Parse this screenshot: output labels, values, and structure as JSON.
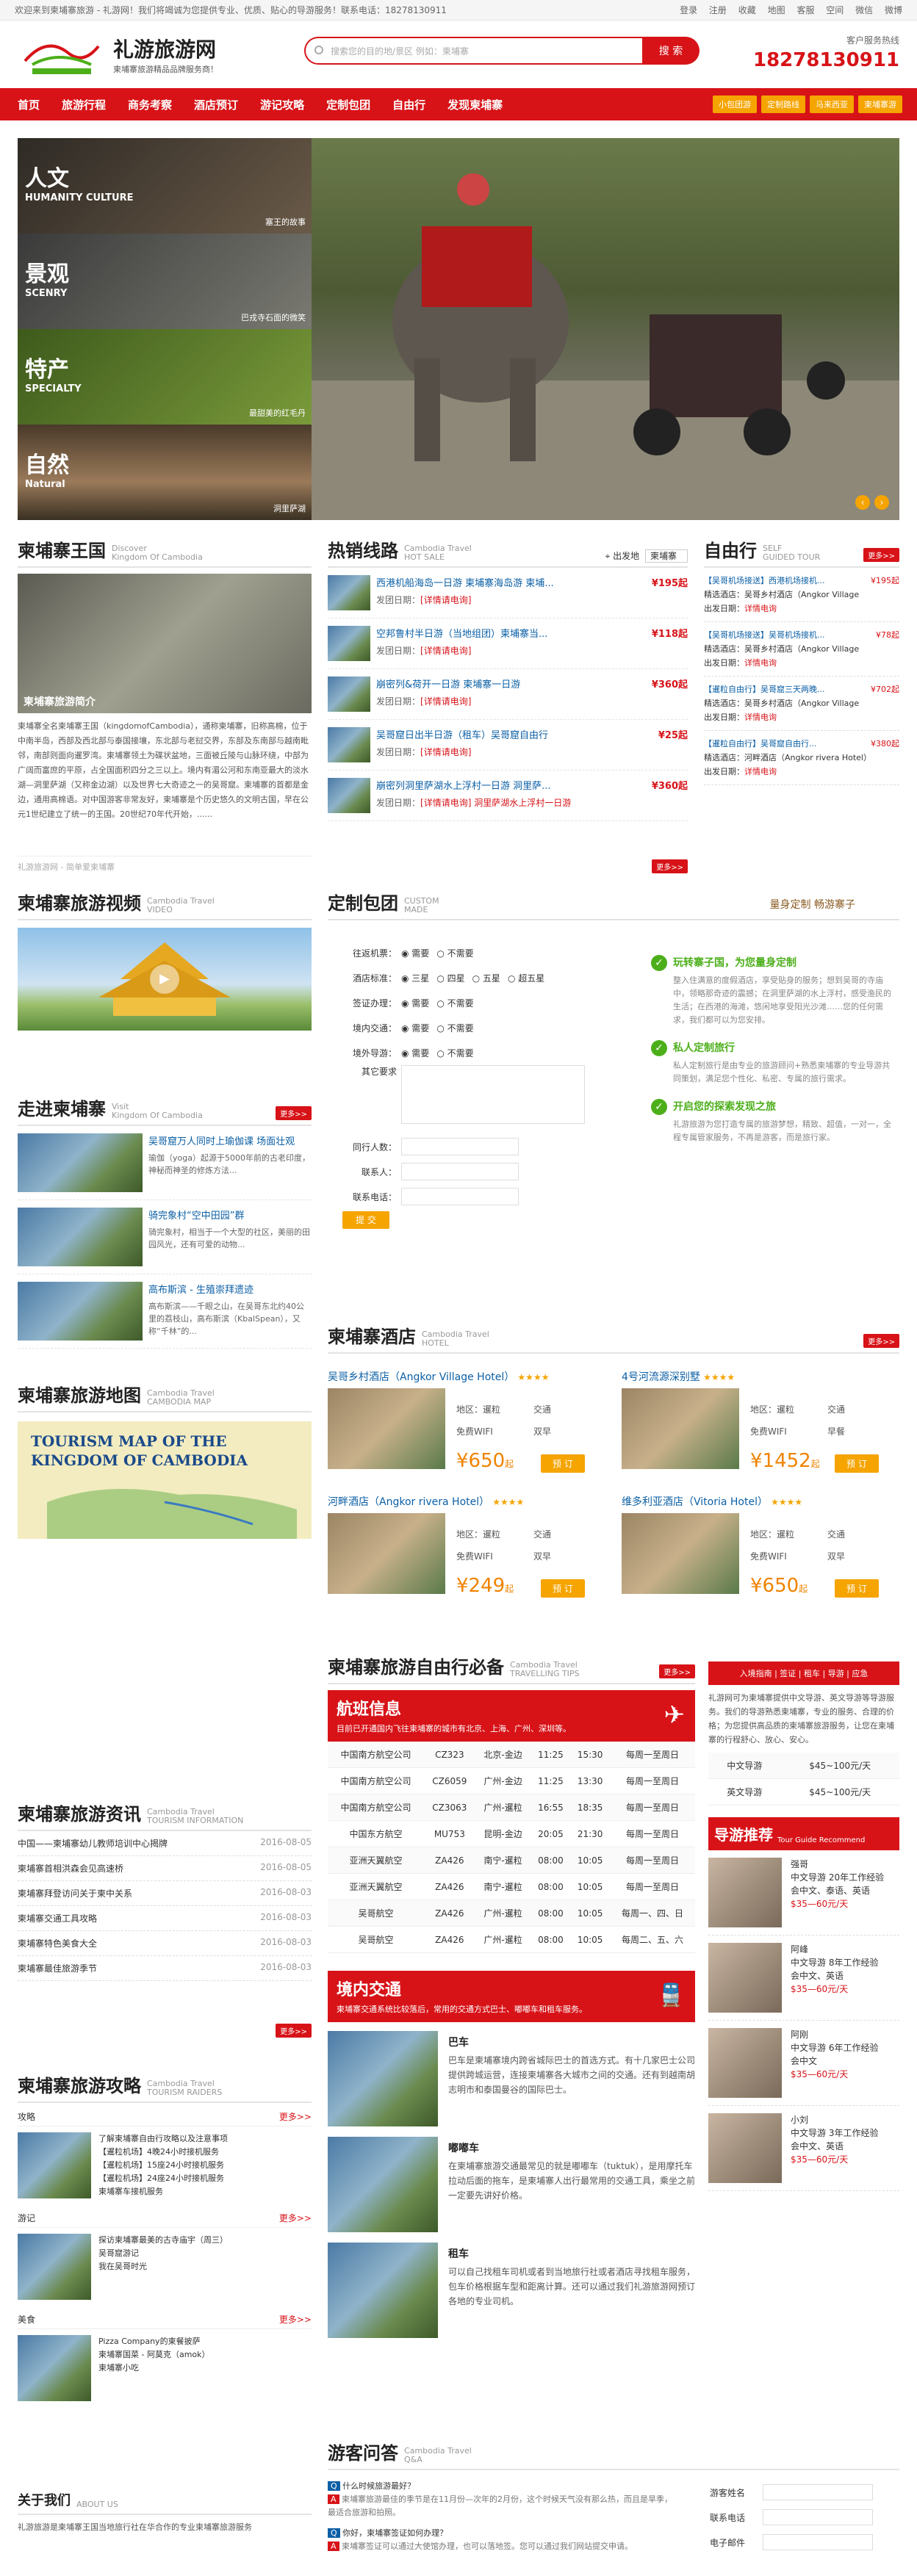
{
  "topbar": {
    "welcome": "欢迎来到柬埔寨旅游 - 礼游网！我们将竭诚为您提供专业、优质、贴心的导游服务！联系电话：18278130911",
    "links": [
      "登录",
      "注册",
      "收藏",
      "地图",
      "客服",
      "空间",
      "微信",
      "微博"
    ]
  },
  "header": {
    "site_name": "礼游旅游网",
    "slogan": "柬埔寨旅游精品品牌服务商！",
    "search_placeholder": "搜索您的目的地/景区 例如：柬埔寨",
    "search_button": "搜 索",
    "hotline_label": "客户服务热线",
    "hotline": "18278130911"
  },
  "nav": {
    "items": [
      "首页",
      "旅游行程",
      "商务考察",
      "酒店预订",
      "游记攻略",
      "定制包团",
      "自由行",
      "发现柬埔寨"
    ],
    "tags": [
      "小包团游",
      "定制路线",
      "马来西亚",
      "柬埔寨游"
    ]
  },
  "banner": {
    "cells": [
      {
        "t": "人文",
        "e": "HUMANITY CULTURE",
        "cap": "塞王的故事"
      },
      {
        "t": "景观",
        "e": "SCENRY",
        "cap": "巴戎寺石面的微笑"
      },
      {
        "t": "特产",
        "e": "SPECIALTY",
        "cap": "最甜美的红毛丹"
      },
      {
        "t": "自然",
        "e": "Natural",
        "cap": "洞里萨湖"
      }
    ]
  },
  "kingdom": {
    "title": "柬埔寨王国",
    "en1": "Discover",
    "en2": "Kingdom Of Cambodia",
    "img_caption": "柬埔寨旅游简介",
    "desc": "柬埔寨全名柬埔寨王国（kingdomofCambodia），通称柬埔寨，旧称高棉，位于中南半岛，西部及西北部与泰国接壤，东北部与老挝交界，东部及东南部与越南毗邻，南部则面向暹罗湾。柬埔寨领土为碟状盆地，三面被丘陵与山脉环绕，中部为广阔而富庶的平原，占全国面积四分之三以上。境内有湄公河和东南亚最大的淡水湖—洞里萨湖（又称金边湖）以及世界七大奇迹之一的吴哥窟。柬埔寨的首都是金边，通用高棉语。对中国游客非常友好，柬埔寨是个历史悠久的文明古国，早在公元1世纪建立了统一的王国。20世纪70年代开始，......",
    "footer": "礼游旅游网 - 简单爱柬埔寨"
  },
  "hot": {
    "title": "热销线路",
    "en1": "Cambodia Travel",
    "en2": "HOT SALE",
    "depart_label": "出发地",
    "depart": "柬埔寨",
    "items": [
      {
        "name": "西港机船海岛一日游 柬埔寨海岛游 柬埔...",
        "date": "发团日期：",
        "date_v": "[详情请电询]",
        "price": "¥195起"
      },
      {
        "name": "空邦鲁村半日游（当地组团）柬埔寨当...",
        "date": "发团日期：",
        "date_v": "[详情请电询]",
        "price": "¥118起"
      },
      {
        "name": "崩密列&荷开一日游 柬埔寨一日游",
        "date": "发团日期：",
        "date_v": "[详情请电询]",
        "price": "¥360起"
      },
      {
        "name": "吴哥窟日出半日游（租车）吴哥窟自由行",
        "date": "发团日期：",
        "date_v": "[详情请电询]",
        "price": "¥25起"
      },
      {
        "name": "崩密列洞里萨湖水上浮村一日游 洞里萨...",
        "date": "发团日期：",
        "date_v": "[详情请电询] 洞里萨湖水上浮村一日游",
        "price": "¥360起"
      }
    ],
    "more": "更多>>"
  },
  "free": {
    "title": "自由行",
    "en1": "SELF",
    "en2": "GUIDED TOUR",
    "more": "更多>>",
    "items": [
      {
        "name": "【吴哥机场接送】西港机场接机...",
        "price": "¥195起",
        "hotel": "精选酒店：吴哥乡村酒店（Angkor Village",
        "date_v": "详情电询"
      },
      {
        "name": "【吴哥机场接送】吴哥机场接机...",
        "price": "¥78起",
        "hotel": "精选酒店：吴哥乡村酒店（Angkor Village",
        "date_v": "详情电询"
      },
      {
        "name": "【暹粒自由行】吴哥窟三天两晚...",
        "price": "¥702起",
        "hotel": "精选酒店：吴哥乡村酒店（Angkor Village",
        "date_v": "详情电询"
      },
      {
        "name": "【暹粒自由行】吴哥窟自由行...",
        "price": "¥380起",
        "hotel": "精选酒店：河畔酒店（Angkor rivera Hotel）",
        "date_v": "详情电询"
      }
    ],
    "date_label": "出发日期："
  },
  "video": {
    "title": "柬埔寨旅游视频",
    "en1": "Cambodia Travel",
    "en2": "VIDEO"
  },
  "custom": {
    "title": "定制包团",
    "en1": "CUSTOM",
    "en2": "MADE",
    "slogan": "量身定制 畅游寨子",
    "fields": [
      {
        "lb": "往返机票：",
        "ops": [
          "需要",
          "不需要"
        ]
      },
      {
        "lb": "酒店标准：",
        "ops": [
          "三星",
          "四星",
          "五星",
          "超五星"
        ]
      },
      {
        "lb": "签证办理：",
        "ops": [
          "需要",
          "不需要"
        ]
      },
      {
        "lb": "境内交通：",
        "ops": [
          "需要",
          "不需要"
        ]
      },
      {
        "lb": "境外导游：",
        "ops": [
          "需要",
          "不需要"
        ]
      }
    ],
    "other": "其它要求",
    "people": "同行人数：",
    "contact": "联系人：",
    "phone": "联系电话：",
    "submit": "提 交",
    "checks": [
      {
        "h": "玩转寨子国，为您量身定制",
        "p": "整入住满意的度假酒店，享受贴身的服务；想到吴哥的寺庙中，领略那奇迹的震撼；在洞里萨湖的水上浮村，感受渔民的生活；在西港的海滩，悠闲地享受阳光沙滩……您的任何需求，我们都可以为您安排。"
      },
      {
        "h": "私人定制旅行",
        "p": "私人定制旅行是由专业的旅游顾问+熟悉柬埔寨的专业导游共同策划，满足您个性化、私密、专属的旅行需求。"
      },
      {
        "h": "开启您的探索发现之旅",
        "p": "礼游旅游为您打造专属的旅游梦想，精致、超值，一对一，全程专属管家服务，不再是游客，而是旅行家。"
      }
    ]
  },
  "visit": {
    "title": "走进柬埔寨",
    "en1": "Visit",
    "en2": "Kingdom Of Cambodia",
    "more": "更多>>",
    "items": [
      {
        "h": "吴哥窟万人同时上瑜伽课 场面壮观",
        "p": "瑜伽（yoga）起源于5000年前的古老印度，神秘而神圣的修炼方法..."
      },
      {
        "h": "骑完象村“空中田园”群",
        "p": "骑完象村，相当于一个大型的社区，美丽的田园风光，还有可爱的动物..."
      },
      {
        "h": "高布斯滨 - 生殖崇拜遗迹",
        "p": "高布斯滨——千眼之山，在吴哥东北约40公里的荔枝山，高布斯滨（KbalSpean），又称“千林”的..."
      }
    ]
  },
  "hotel": {
    "title": "柬埔寨酒店",
    "en1": "Cambodia Travel",
    "en2": "HOTEL",
    "more": "更多>>",
    "items": [
      {
        "name": "吴哥乡村酒店（Angkor Village Hotel）",
        "stars": "★★★★",
        "loc": "地区：暹粒",
        "a1": "交通",
        "a2": "免费WIFI",
        "a3": "双早",
        "price": "¥650",
        "unit": "起",
        "book": "预 订"
      },
      {
        "name": "4号河流源深别墅",
        "stars": "★★★★",
        "loc": "地区：暹粒",
        "a1": "交通",
        "a2": "免费WIFI",
        "a3": "早餐",
        "price": "¥1452",
        "unit": "起",
        "book": "预 订"
      },
      {
        "name": "河畔酒店（Angkor rivera Hotel）",
        "stars": "★★★★",
        "loc": "地区：暹粒",
        "a1": "交通",
        "a2": "免费WIFI",
        "a3": "双早",
        "price": "¥249",
        "unit": "起",
        "book": "预 订"
      },
      {
        "name": "维多利亚酒店（Vitoria Hotel）",
        "stars": "★★★★",
        "loc": "地区：暹粒",
        "a1": "交通",
        "a2": "免费WIFI",
        "a3": "双早",
        "price": "¥650",
        "unit": "起",
        "book": "预 订"
      }
    ]
  },
  "map": {
    "title": "柬埔寨旅游地图",
    "en1": "Cambodia Travel",
    "en2": "CAMBODIA MAP",
    "img_title": "TOURISM MAP OF THE KINGDOM OF CAMBODIA"
  },
  "tips": {
    "title": "柬埔寨旅游自由行必备",
    "en1": "Cambodia Travel",
    "en2": "TRAVELLING TIPS",
    "more": "更多>>",
    "flight_title": "航班信息",
    "flight_sub": "目前已开通国内飞往柬埔寨的城市有北京、上海、广州、深圳等。",
    "flights": [
      [
        "中国南方航空公司",
        "CZ323",
        "北京-金边",
        "11:25",
        "15:30",
        "每周一至周日"
      ],
      [
        "中国南方航空公司",
        "CZ6059",
        "广州-金边",
        "11:25",
        "13:30",
        "每周一至周日"
      ],
      [
        "中国南方航空公司",
        "CZ3063",
        "广州-暹粒",
        "16:55",
        "18:35",
        "每周一至周日"
      ],
      [
        "中国东方航空",
        "MU753",
        "昆明-金边",
        "20:05",
        "21:30",
        "每周一至周日"
      ],
      [
        "亚洲天翼航空",
        "ZA426",
        "南宁-暹粒",
        "08:00",
        "10:05",
        "每周一至周日"
      ],
      [
        "亚洲天翼航空",
        "ZA426",
        "南宁-暹粒",
        "08:00",
        "10:05",
        "每周一至周日"
      ],
      [
        "吴哥航空",
        "ZA426",
        "广州-暹粒",
        "08:00",
        "10:05",
        "每周一、四、日"
      ],
      [
        "吴哥航空",
        "ZA426",
        "广州-暹粒",
        "08:00",
        "10:05",
        "每周二、五、六"
      ]
    ],
    "trans_title": "境内交通",
    "trans_sub": "柬埔寨交通系统比较落后，常用的交通方式巴士、嘟嘟车和租车服务。",
    "trans": [
      {
        "h": "巴车",
        "p": "巴车是柬埔寨境内跨省城际巴士的首选方式。有十几家巴士公司提供跨城运营，连接柬埔寨各大城市之间的交通。还有到越南胡志明市和泰国曼谷的国际巴士。"
      },
      {
        "h": "嘟嘟车",
        "p": "在柬埔寨旅游交通最常见的就是嘟嘟车（tuktuk），是用摩托车拉动后面的拖车，是柬埔寨人出行最常用的交通工具，乘坐之前一定要先讲好价格。"
      },
      {
        "h": "租车",
        "p": "可以自己找租车司机或者到当地旅行社或者酒店寻找租车服务，包车价格根据车型和距离计算。还可以通过我们礼游旅游网预订各地的专业司机。"
      }
    ]
  },
  "visa": {
    "tabs": "入境指南 | 签证 | 租车 | 导游 | 应急",
    "text": "礼游网可为柬埔寨提供中文导游、英文导游等导游服务。我们的导游熟悉柬埔寨，专业的服务、合理的价格；为您提供高品质的柬埔寨旅游服务，让您在柬埔寨的行程舒心、放心、安心。",
    "rows": [
      [
        "中文导游",
        "$45~100元/天"
      ],
      [
        "英文导游",
        "$45~100元/天"
      ]
    ]
  },
  "guides": {
    "title": "导游推荐",
    "en": "Tour Guide Recommend",
    "items": [
      {
        "n": "强哥",
        "l": "中文导游 20年工作经验",
        "c": "会中文、泰语、英语",
        "p": "$35—60元/天"
      },
      {
        "n": "阿峰",
        "l": "中文导游 8年工作经验",
        "c": "会中文、英语",
        "p": "$35—60元/天"
      },
      {
        "n": "阿刚",
        "l": "中文导游 6年工作经验",
        "c": "会中文",
        "p": "$35—60元/天"
      },
      {
        "n": "小刘",
        "l": "中文导游 3年工作经验",
        "c": "会中文、英语",
        "p": "$35—60元/天"
      }
    ]
  },
  "news": {
    "title": "柬埔寨旅游资讯",
    "en1": "Cambodia Travel",
    "en2": "TOURISM INFORMATION",
    "more": "更多>>",
    "items": [
      {
        "t": "中国——柬埔寨幼儿教师培训中心揭牌",
        "d": "2016-08-05"
      },
      {
        "t": "柬埔寨首相洪森会见高速桥",
        "d": "2016-08-05"
      },
      {
        "t": "柬埔寨拜登访问关于柬中关系",
        "d": "2016-08-03"
      },
      {
        "t": "柬埔寨交通工具攻略",
        "d": "2016-08-03"
      },
      {
        "t": "柬埔寨特色美食大全",
        "d": "2016-08-03"
      },
      {
        "t": "柬埔寨最佳旅游季节",
        "d": "2016-08-03"
      }
    ]
  },
  "raiders": {
    "title": "柬埔寨旅游攻略",
    "en1": "Cambodia Travel",
    "en2": "TOURISM RAIDERS",
    "groups": [
      {
        "n": "攻略",
        "more": "更多>>",
        "items": [
          "了解柬埔寨自由行攻略以及注意事项",
          "【暹粒机场】4晚24小时接机服务",
          "【暹粒机场】15座24小时接机服务",
          "【暹粒机场】24座24小时接机服务",
          "柬埔寨车接机服务"
        ]
      },
      {
        "n": "游记",
        "more": "更多>>",
        "items": [
          "探访柬埔寨最美的古寺庙宇（周三）",
          "吴哥窟游记",
          "我在吴哥时光"
        ]
      },
      {
        "n": "美食",
        "more": "更多>>",
        "items": [
          "Pizza Company的柬餐披萨",
          "柬埔寨国菜 - 阿莫克（amok）",
          "柬埔寨小吃"
        ]
      }
    ]
  },
  "qa": {
    "title": "游客问答",
    "en1": "Cambodia Travel",
    "en2": "Q&A",
    "items": [
      {
        "q": "什么时候旅游最好？",
        "a": "柬埔寨旅游最佳的季节是在11月份—次年的2月份，这个时候天气没有那么热，而且是旱季，最适合旅游和拍照。"
      },
      {
        "q": "你好，柬埔寨签证如何办理？",
        "a": "柬埔寨签证可以通过大使馆办理，也可以落地签。您可以通过我们网站提交申请。"
      }
    ],
    "form": [
      "游客姓名",
      "联系电话",
      "电子邮件"
    ]
  },
  "about": {
    "title": "关于我们",
    "en": "ABOUT US",
    "text": "礼游旅游是柬埔寨王国当地旅行社在华合作的专业柬埔寨旅游服务"
  }
}
